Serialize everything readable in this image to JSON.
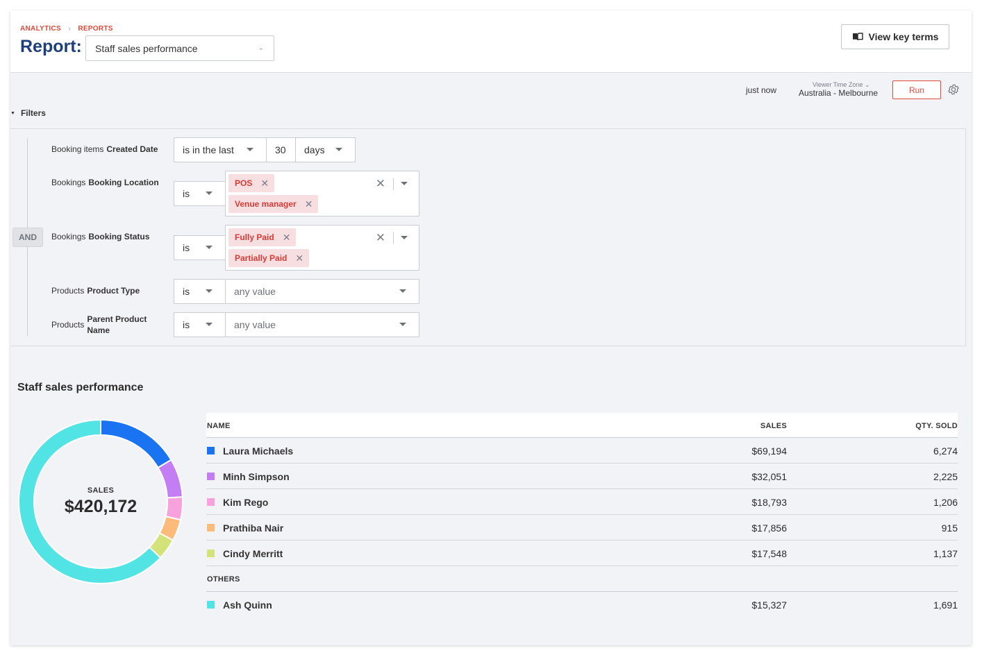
{
  "header": {
    "breadcrumb": [
      "ANALYTICS",
      "REPORTS"
    ],
    "title": "Report:",
    "report_select": "Staff sales performance",
    "key_terms_label": "View key terms"
  },
  "toolbar": {
    "status": "just now",
    "timezone_label": "Viewer Time Zone",
    "timezone_value": "Australia - Melbourne",
    "run_label": "Run"
  },
  "filters": {
    "toggle_label": "Filters",
    "and_label": "AND",
    "rows": [
      {
        "entity": "Booking items",
        "field": "Created Date",
        "operator": "is in the last",
        "value": "30",
        "unit": "days"
      },
      {
        "entity": "Bookings",
        "field": "Booking Location",
        "operator": "is",
        "chips": [
          "POS",
          "Venue manager"
        ]
      },
      {
        "entity": "Bookings",
        "field": "Booking Status",
        "operator": "is",
        "chips": [
          "Fully Paid",
          "Partially Paid"
        ]
      },
      {
        "entity": "Products",
        "field": "Product Type",
        "operator": "is",
        "placeholder": "any value"
      },
      {
        "entity": "Products",
        "field": "Parent Product Name",
        "field_line1": "Parent Product",
        "field_line2": "Name",
        "operator": "is",
        "placeholder": "any value"
      }
    ]
  },
  "report": {
    "section_title": "Staff sales performance",
    "total_label": "SALES",
    "total_value": "$420,172",
    "columns": [
      "NAME",
      "SALES",
      "QTY. SOLD"
    ],
    "others_label": "OTHERS",
    "rows": [
      {
        "name": "Laura Michaels",
        "sales": "$69,194",
        "qty": "6,274",
        "color": "#1a73f0"
      },
      {
        "name": "Minh Simpson",
        "sales": "$32,051",
        "qty": "2,225",
        "color": "#c27ef2"
      },
      {
        "name": "Kim Rego",
        "sales": "$18,793",
        "qty": "1,206",
        "color": "#f7a1dd"
      },
      {
        "name": "Prathiba Nair",
        "sales": "$17,856",
        "qty": "915",
        "color": "#fcbb7a"
      },
      {
        "name": "Cindy Merritt",
        "sales": "$17,548",
        "qty": "1,137",
        "color": "#d3e37a"
      }
    ],
    "other_rows": [
      {
        "name": "Ash Quinn",
        "sales": "$15,327",
        "qty": "1,691",
        "color": "#52e3e5"
      }
    ]
  },
  "chart_data": {
    "type": "pie",
    "categories": [
      "Laura Michaels",
      "Minh Simpson",
      "Kim Rego",
      "Prathiba Nair",
      "Cindy Merritt",
      "Ash Quinn"
    ],
    "values": [
      69194,
      32051,
      18793,
      17856,
      17548,
      264730
    ],
    "colors": [
      "#1a73f0",
      "#c27ef2",
      "#f7a1dd",
      "#fcbb7a",
      "#d3e37a",
      "#52e3e5"
    ],
    "title": "SALES $420,172"
  }
}
